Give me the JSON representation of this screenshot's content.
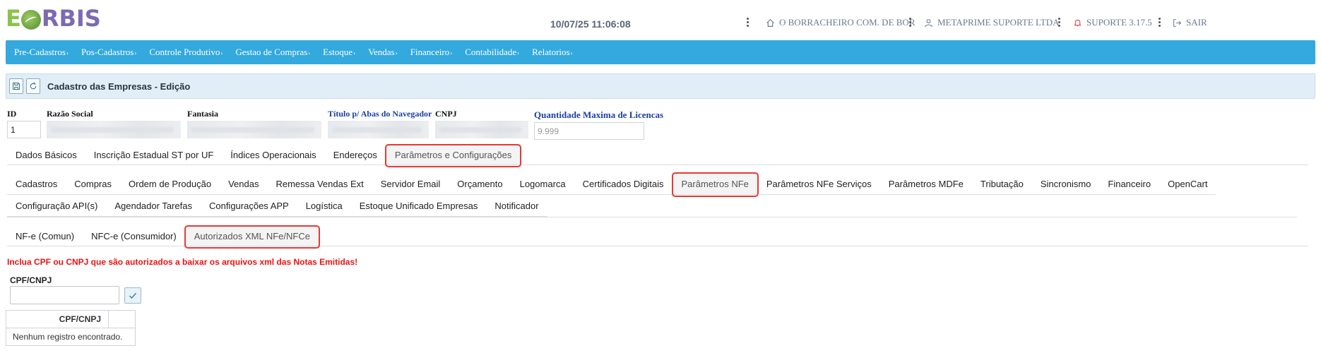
{
  "logo": {
    "prefix": "E",
    "suffix": "RBIS"
  },
  "header": {
    "datetime": "10/07/25 11:06:08",
    "company": "O BORRACHEIRO COM. DE BOR",
    "user": "METAPRIME SUPORTE LTDA",
    "version": "SUPORTE 3.17.5",
    "logout": "SAIR"
  },
  "mainnav": {
    "items": [
      {
        "label": "Pre-Cadastros"
      },
      {
        "label": "Pos-Cadastros"
      },
      {
        "label": "Controle Produtivo"
      },
      {
        "label": "Gestao de Compras"
      },
      {
        "label": "Estoque"
      },
      {
        "label": "Vendas"
      },
      {
        "label": "Financeiro"
      },
      {
        "label": "Contabilidade"
      },
      {
        "label": "Relatorios"
      }
    ]
  },
  "toolbar": {
    "title": "Cadastro das Empresas - Edição"
  },
  "form": {
    "id_label": "ID",
    "id_value": "1",
    "razao_label": "Razão Social",
    "fantasia_label": "Fantasia",
    "titulo_label": "Título p/ Abas do Navegador",
    "cnpj_label": "CNPJ",
    "qtd_label": "Quantidade Maxima de Licencas",
    "qtd_placeholder": "9.999"
  },
  "tabs_level1": [
    {
      "label": "Dados Básicos",
      "active": false
    },
    {
      "label": "Inscrição Estadual ST por UF",
      "active": false
    },
    {
      "label": "Índices Operacionais",
      "active": false
    },
    {
      "label": "Endereços",
      "active": false
    },
    {
      "label": "Parâmetros e Configurações",
      "active": true
    }
  ],
  "tabs_level2": [
    {
      "label": "Cadastros",
      "active": false
    },
    {
      "label": "Compras",
      "active": false
    },
    {
      "label": "Ordem de Produção",
      "active": false
    },
    {
      "label": "Vendas",
      "active": false
    },
    {
      "label": "Remessa Vendas Ext",
      "active": false
    },
    {
      "label": "Servidor Email",
      "active": false
    },
    {
      "label": "Orçamento",
      "active": false
    },
    {
      "label": "Logomarca",
      "active": false
    },
    {
      "label": "Certificados Digitais",
      "active": false
    },
    {
      "label": "Parâmetros NFe",
      "active": true
    },
    {
      "label": "Parâmetros NFe Serviços",
      "active": false
    },
    {
      "label": "Parâmetros MDFe",
      "active": false
    },
    {
      "label": "Tributação",
      "active": false
    },
    {
      "label": "Sincronismo",
      "active": false
    },
    {
      "label": "Financeiro",
      "active": false
    },
    {
      "label": "OpenCart",
      "active": false
    },
    {
      "label": "Configuração API(s)",
      "active": false
    },
    {
      "label": "Agendador Tarefas",
      "active": false
    },
    {
      "label": "Configurações APP",
      "active": false
    },
    {
      "label": "Logística",
      "active": false
    },
    {
      "label": "Estoque Unificado Empresas",
      "active": false
    },
    {
      "label": "Notificador",
      "active": false
    }
  ],
  "tabs_level3": [
    {
      "label": "NF-e (Comun)",
      "active": false
    },
    {
      "label": "NFC-e (Consumidor)",
      "active": false
    },
    {
      "label": "Autorizados XML NFe/NFCe",
      "active": true
    }
  ],
  "content": {
    "hint": "Inclua CPF ou CNPJ que são autorizados a baixar os arquivos xml das Notas Emitidas!",
    "cpf_label": "CPF/CNPJ",
    "table_header": "CPF/CNPJ",
    "empty_message": "Nenhum registro encontrado."
  },
  "colors": {
    "nav_bg": "#33a9dd",
    "toolbar_bg": "#e1eef7",
    "highlight": "#e53935",
    "hint": "#ee1111"
  }
}
